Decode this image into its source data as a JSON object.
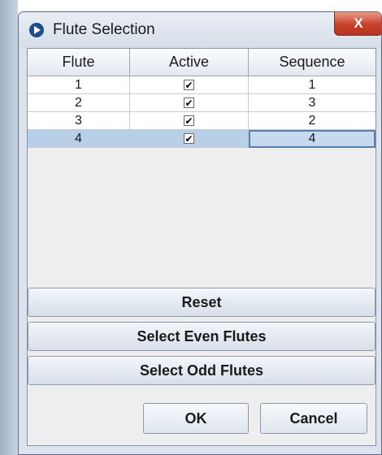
{
  "window": {
    "title": "Flute Selection",
    "close_label": "X"
  },
  "table": {
    "headers": [
      "Flute",
      "Active",
      "Sequence"
    ],
    "rows": [
      {
        "flute": "1",
        "active": true,
        "sequence": "1"
      },
      {
        "flute": "2",
        "active": true,
        "sequence": "3"
      },
      {
        "flute": "3",
        "active": true,
        "sequence": "2"
      },
      {
        "flute": "4",
        "active": true,
        "sequence": "4"
      }
    ],
    "selected_row": 4
  },
  "buttons": {
    "reset": "Reset",
    "select_even": "Select Even Flutes",
    "select_odd": "Select Odd Flutes",
    "ok": "OK",
    "cancel": "Cancel"
  },
  "checkmark_glyph": "✔",
  "colors": {
    "selection": "#b8cfe8",
    "close_button": "#c7402a"
  }
}
